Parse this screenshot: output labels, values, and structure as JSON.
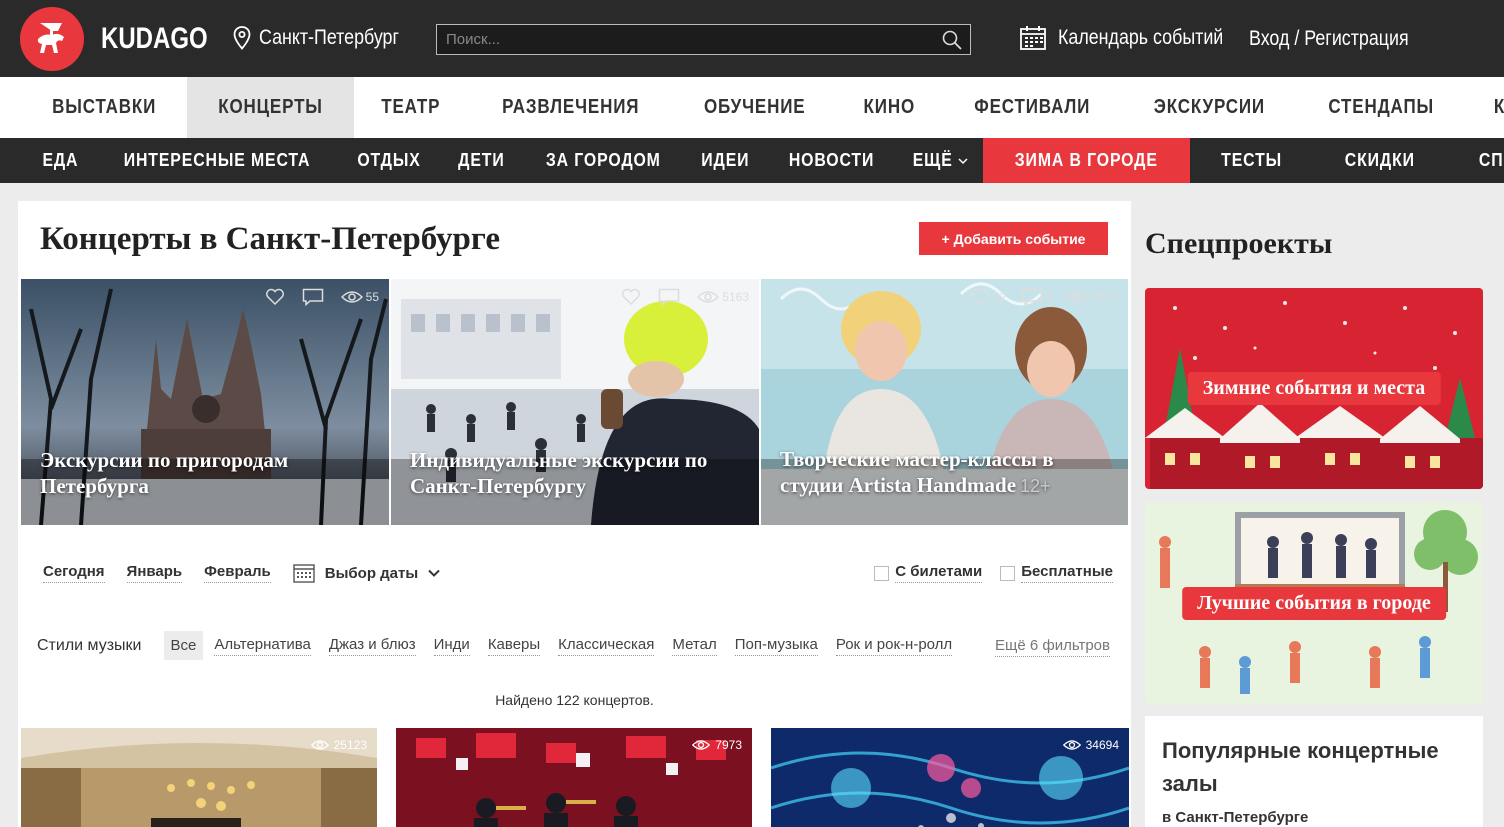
{
  "header": {
    "logo_text": "KUDAGO",
    "city": "Санкт-Петербург",
    "search_placeholder": "Поиск...",
    "calendar_label": "Календарь событий",
    "login_label": "Вход / Регистрация"
  },
  "main_nav": [
    "ВЫСТАВКИ",
    "КОНЦЕРТЫ",
    "ТЕАТР",
    "РАЗВЛЕЧЕНИЯ",
    "ОБУЧЕНИЕ",
    "КИНО",
    "ФЕСТИВАЛИ",
    "ЭКСКУРСИИ",
    "СТЕНДАПЫ",
    "КВЕСТЫ"
  ],
  "main_nav_active": "КОНЦЕРТЫ",
  "sub_nav": [
    "ЕДА",
    "ИНТЕРЕСНЫЕ МЕСТА",
    "ОТДЫХ",
    "ДЕТИ",
    "ЗА ГОРОДОМ",
    "ИДЕИ",
    "НОВОСТИ",
    "ЕЩЁ"
  ],
  "sub_nav_highlight": "ЗИМА В ГОРОДЕ",
  "sub_nav_right": [
    "ТЕСТЫ",
    "СКИДКИ",
    "СПИСКИ"
  ],
  "page": {
    "title": "Концерты в Санкт-Петербурге",
    "add_event": "+ Добавить событие"
  },
  "promos": [
    {
      "title_line1": "Экскурсии по пригородам",
      "title_line2": "Петербурга",
      "age": "",
      "likes": "",
      "comments": "",
      "views": "55"
    },
    {
      "title_line1": "Индивидуальные экскурсии по",
      "title_line2": "Санкт-Петербургу",
      "age": "",
      "likes": "",
      "comments": "",
      "views": "5163"
    },
    {
      "title_line1": "Творческие мастер-классы в",
      "title_line2": "студии Artista Handmade",
      "age": "12+",
      "likes": "22",
      "comments": "5",
      "views": "8070"
    }
  ],
  "date_filters": {
    "today": "Сегодня",
    "january": "Январь",
    "february": "Февраль",
    "pick_date": "Выбор даты"
  },
  "checkbox_filters": {
    "with_tickets": "С билетами",
    "free": "Бесплатные"
  },
  "music_styles": {
    "label": "Стили музыки",
    "tags": [
      "Все",
      "Альтернатива",
      "Джаз и блюз",
      "Инди",
      "Каверы",
      "Классическая",
      "Метал",
      "Поп-музыка",
      "Рок и рок-н-ролл"
    ],
    "active": "Все",
    "more": "Ещё 6 фильтров"
  },
  "found_text": "Найдено 122 концертов.",
  "cards": [
    {
      "views": "25123"
    },
    {
      "views": "7973"
    },
    {
      "views": "34694"
    }
  ],
  "sidebar": {
    "title": "Спецпроекты",
    "banner1": "Зимние события и места",
    "banner2": "Лучшие события в городе",
    "popular_title": "Популярные концертные залы",
    "popular_sub": "в Санкт-Петербурге"
  },
  "colors": {
    "brand_red": "#e8383d",
    "dark_bar": "#2a2a2a"
  }
}
